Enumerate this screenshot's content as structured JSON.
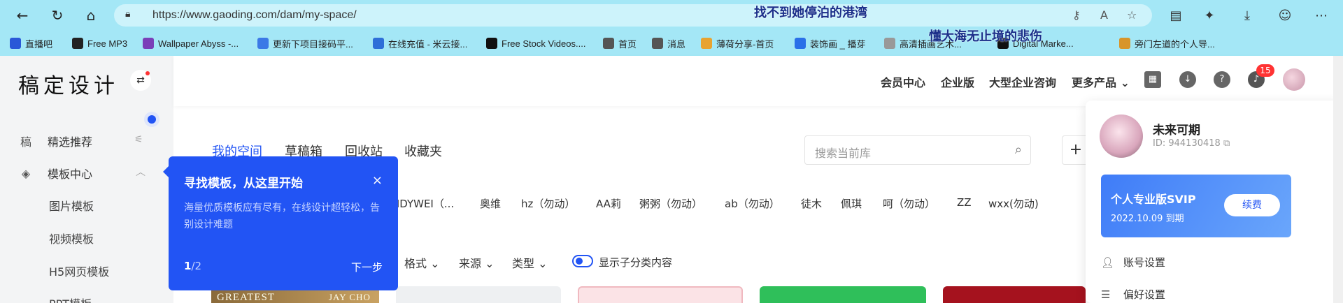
{
  "browser": {
    "url": "https://www.gaoding.com/dam/my-space/",
    "overlay_text_1": "找不到她停泊的港湾",
    "overlay_text_2": "懂大海无止境的悲伤",
    "bookmarks": [
      {
        "label": "直播吧",
        "color": "#2a58d8"
      },
      {
        "label": "Free MP3",
        "color": "#222222"
      },
      {
        "label": "Wallpaper Abyss -...",
        "color": "#7a3fb8"
      },
      {
        "label": "更新下项目接码平...",
        "color": "#3b79e6"
      },
      {
        "label": "在线充值 - 米云接...",
        "color": "#2e6fd8"
      },
      {
        "label": "Free Stock Videos....",
        "color": "#111111"
      },
      {
        "label": "首页",
        "color": "#555555"
      },
      {
        "label": "消息",
        "color": "#555555"
      },
      {
        "label": "薄荷分享-首页",
        "color": "#e8a330"
      },
      {
        "label": "装饰画 _ 播芽",
        "color": "#2a70e8"
      },
      {
        "label": "高清插画艺术...",
        "color": "#999999"
      },
      {
        "label": "Digital Marke...",
        "color": "#111111"
      },
      {
        "label": "旁门左道的个人导...",
        "color": "#d8952a"
      }
    ]
  },
  "sidebar": {
    "logo": "稿定设计",
    "items": [
      {
        "label": "精选推荐",
        "icon": "稿"
      },
      {
        "label": "模板中心",
        "icon": "◈"
      }
    ],
    "sub_items": [
      "图片模板",
      "视频模板",
      "H5网页模板",
      "PPT模板"
    ]
  },
  "header": {
    "links": [
      "会员中心",
      "企业版",
      "大型企业咨询",
      "更多产品"
    ],
    "badge": "15"
  },
  "main": {
    "tabs": [
      "我的空间",
      "草稿箱",
      "回收站",
      "收藏夹"
    ],
    "search_placeholder": "搜索当前库",
    "members": [
      "NDYWEI（...",
      "奥维",
      "hz（勿动）",
      "AA莉",
      "粥粥（勿动）",
      "ab（勿动）",
      "徒木",
      "佩琪",
      "呵（勿动）",
      "ZZ",
      "wxx(勿动)"
    ],
    "filters": [
      "格式",
      "来源",
      "类型"
    ],
    "toggle_label": "显示子分类内容",
    "card_text": "GREATEST",
    "card_text_2": "JAY CHO"
  },
  "tooltip": {
    "title": "寻找模板，从这里开始",
    "body": "海量优质模板应有尽有，在线设计超轻松，告别设计难题",
    "page_current": "1",
    "page_total": "/2",
    "next": "下一步",
    "close": "×"
  },
  "profile": {
    "name": "未来可期",
    "id": "ID: 944130418",
    "vip_title": "个人专业版SVIP",
    "vip_date": "2022.10.09 到期",
    "renew": "续费",
    "menu": [
      "账号设置",
      "偏好设置"
    ]
  }
}
